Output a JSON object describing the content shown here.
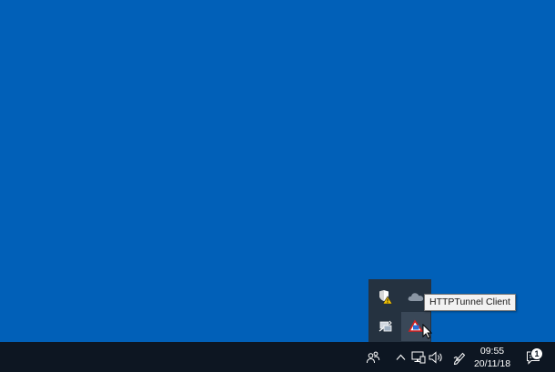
{
  "desktop": {
    "background": "#0160b8"
  },
  "taskbar": {
    "background": "#0d1622",
    "people_icon": "people-icon",
    "overflow_icon": "chevron-up-icon",
    "network_icon": "network-icon",
    "volume_icon": "volume-icon",
    "pen_icon": "windows-ink-icon",
    "action_center_icon": "action-center-icon"
  },
  "clock": {
    "time": "09:55",
    "date": "20/11/18"
  },
  "notifications": {
    "count": "1"
  },
  "overflow_tray": {
    "icons": [
      {
        "name": "windows-security-icon"
      },
      {
        "name": "onedrive-icon"
      },
      {
        "name": "network-share-icon"
      },
      {
        "name": "httptunnel-client-icon"
      }
    ]
  },
  "tooltip": {
    "text": "HTTPTunnel Client"
  }
}
